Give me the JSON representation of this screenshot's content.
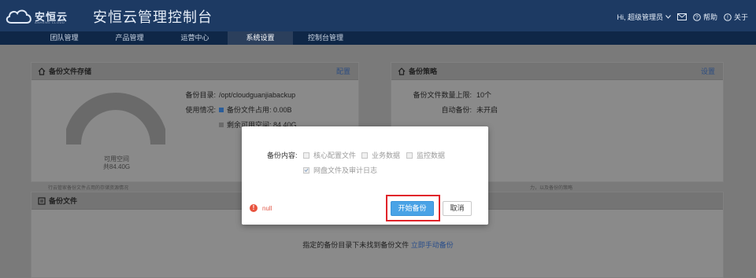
{
  "header": {
    "logo_text": "安恒云",
    "logo_sub": "ANHENG CLOUD",
    "app_title": "安恒云管理控制台",
    "user_greeting": "Hi,  超级管理员",
    "help_label": "帮助",
    "about_label": "关于"
  },
  "nav": {
    "tabs": [
      {
        "label": "团队管理"
      },
      {
        "label": "产品管理"
      },
      {
        "label": "运营中心"
      },
      {
        "label": "系统设置"
      },
      {
        "label": "控制台管理"
      }
    ],
    "active_index": 3
  },
  "storage_panel": {
    "title": "备份文件存储",
    "config_link": "配置",
    "gauge_label": "可用空间",
    "gauge_value": "共84.40G",
    "dir_key": "备份目录:",
    "dir_value": "/opt/cloudguanjiabackup",
    "usage_key": "使用情况:",
    "used_label": "备份文件占用: 0.00B",
    "free_label": "剩余可用空间: 84.40G",
    "footnote": "行云管家备份文件占用的存储资源情况",
    "used_color": "#2a5d9a",
    "free_color": "#6a6a6a"
  },
  "policy_panel": {
    "title": "备份策略",
    "settings_link": "设置",
    "max_key": "备份文件数量上限:",
    "max_value": "10个",
    "auto_key": "自动备份:",
    "auto_value": "未开启",
    "footnote": "力，以及备份的策略"
  },
  "files_panel": {
    "title": "备份文件",
    "empty_text": "指定的备份目录下未找到备份文件",
    "manual_link": "立即手动备份"
  },
  "modal": {
    "content_label": "备份内容:",
    "options": [
      {
        "label": "核心配置文件",
        "checked": false
      },
      {
        "label": "业务数据",
        "checked": false
      },
      {
        "label": "监控数据",
        "checked": false
      },
      {
        "label": "网盘文件及审计日志",
        "checked": true
      }
    ],
    "error_text": "null",
    "start_button": "开始备份",
    "cancel_button": "取消",
    "primary_color": "#4aa3e6",
    "error_color": "#e8543f"
  }
}
